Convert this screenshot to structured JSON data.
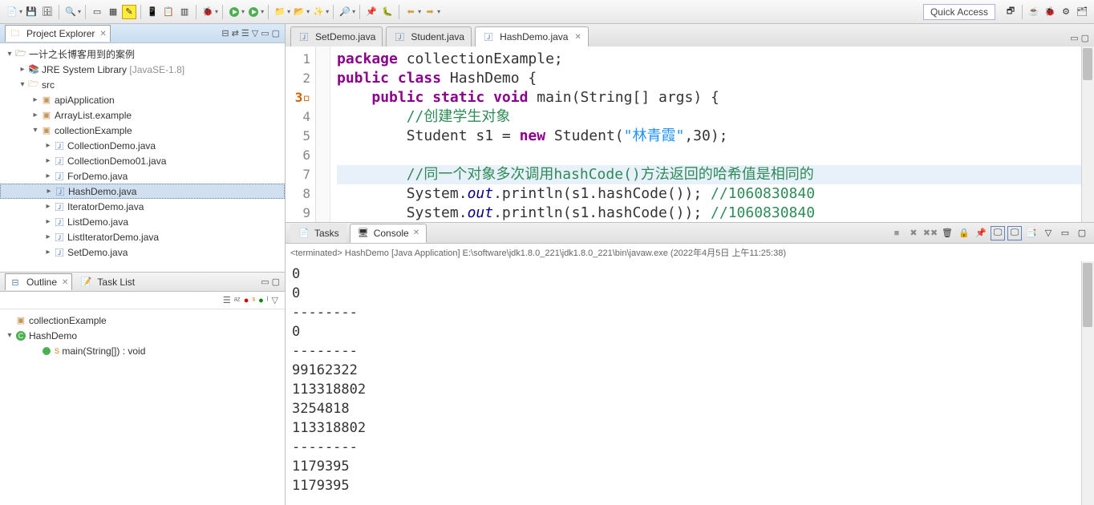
{
  "quick_access": "Quick Access",
  "project_explorer": {
    "title": "Project Explorer",
    "root": "一计之长博客用到的案例",
    "jre": "JRE System Library",
    "jre_ver": "[JavaSE-1.8]",
    "src": "src",
    "packages": [
      "apiApplication",
      "ArrayList.example",
      "collectionExample"
    ],
    "files": [
      "CollectionDemo.java",
      "CollectionDemo01.java",
      "ForDemo.java",
      "HashDemo.java",
      "IteratorDemo.java",
      "ListDemo.java",
      "ListIteratorDemo.java",
      "SetDemo.java"
    ]
  },
  "outline": {
    "title": "Outline",
    "task_title": "Task List",
    "pkg": "collectionExample",
    "cls": "HashDemo",
    "method": "main(String[]) : void"
  },
  "editor": {
    "tabs": [
      "SetDemo.java",
      "Student.java",
      "HashDemo.java"
    ],
    "active": 2,
    "lines": [
      1,
      2,
      3,
      4,
      5,
      6,
      7,
      8,
      9
    ],
    "code": {
      "l1": "package collectionExample;",
      "l2a": "public class",
      "l2b": " HashDemo {",
      "l3a": "public static void",
      "l3b": " main(String[] args) {",
      "l4": "//创建学生对象",
      "l5a": "Student s1 = ",
      "l5b": "new",
      "l5c": " Student(",
      "l5d": "\"林青霞\"",
      "l5e": ",30);",
      "l7": "//同一个对象多次调用hashCode()方法返回的哈希值是相同的",
      "l8a": "System.",
      "l8b": "out",
      "l8c": ".println(s1.hashCode()); ",
      "l8d": "//1060830840",
      "l9a": "System.",
      "l9b": "out",
      "l9c": ".println(s1.hashCode()); ",
      "l9d": "//1060830840"
    }
  },
  "console": {
    "tabs": [
      "Tasks",
      "Console"
    ],
    "term": "<terminated> HashDemo [Java Application] E:\\software\\jdk1.8.0_221\\jdk1.8.0_221\\bin\\javaw.exe (2022年4月5日 上午11:25:38)",
    "output": "0\n0\n--------\n0\n--------\n99162322\n113318802\n3254818\n113318802\n--------\n1179395\n1179395"
  }
}
